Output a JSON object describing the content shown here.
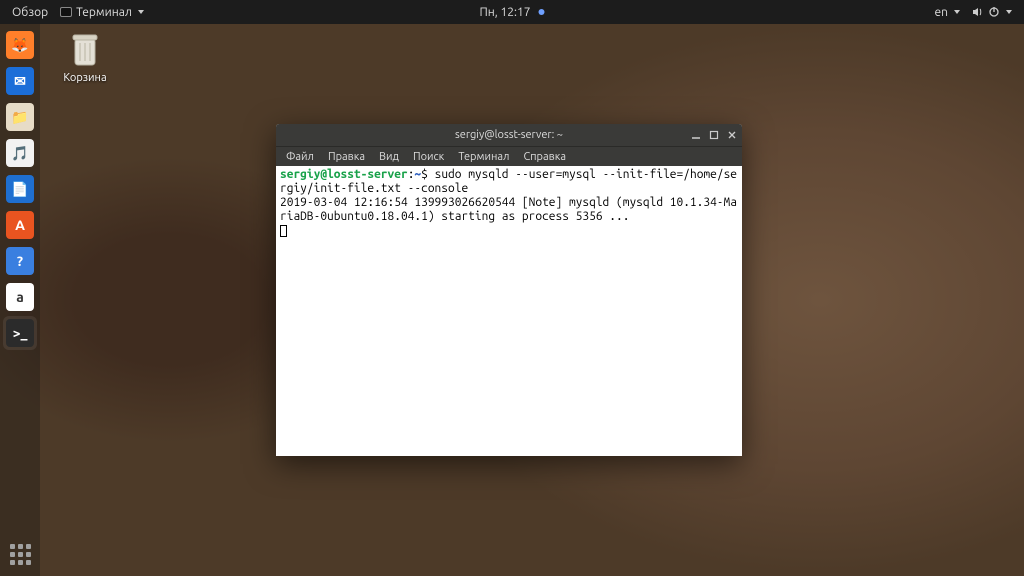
{
  "topbar": {
    "activities": "Обзор",
    "app_indicator": "Терминал",
    "clock": "Пн, 12:17",
    "lang": "en"
  },
  "dock": {
    "items": [
      {
        "name": "firefox",
        "bg": "#ff7f2a",
        "glyph": "🦊"
      },
      {
        "name": "thunderbird",
        "bg": "#1c6ed8",
        "glyph": "✉"
      },
      {
        "name": "files",
        "bg": "#e7dcc7",
        "glyph": "📁"
      },
      {
        "name": "rhythmbox",
        "bg": "#f2f2f2",
        "glyph": "🎵"
      },
      {
        "name": "writer",
        "bg": "#1f6fd0",
        "glyph": "📄"
      },
      {
        "name": "software",
        "bg": "#e95420",
        "glyph": "A"
      },
      {
        "name": "help",
        "bg": "#3a7fe0",
        "glyph": "?"
      },
      {
        "name": "amazon",
        "bg": "#ffffff",
        "glyph": "a"
      },
      {
        "name": "terminal",
        "bg": "#2b2b2b",
        "glyph": ">_"
      }
    ],
    "active_index": 8
  },
  "desktop": {
    "trash_label": "Корзина"
  },
  "window": {
    "title": "sergiy@losst-server: ~",
    "menus": [
      "Файл",
      "Правка",
      "Вид",
      "Поиск",
      "Терминал",
      "Справка"
    ]
  },
  "terminal": {
    "user": "sergiy",
    "host": "losst-server",
    "path": "~",
    "command": "sudo mysqld --user=mysql --init-file=/home/sergiy/init-file.txt --console",
    "output_line": "2019-03-04 12:16:54 139993026620544 [Note] mysqld (mysqld 10.1.34-MariaDB-0ubuntu0.18.04.1) starting as process 5356 ..."
  }
}
